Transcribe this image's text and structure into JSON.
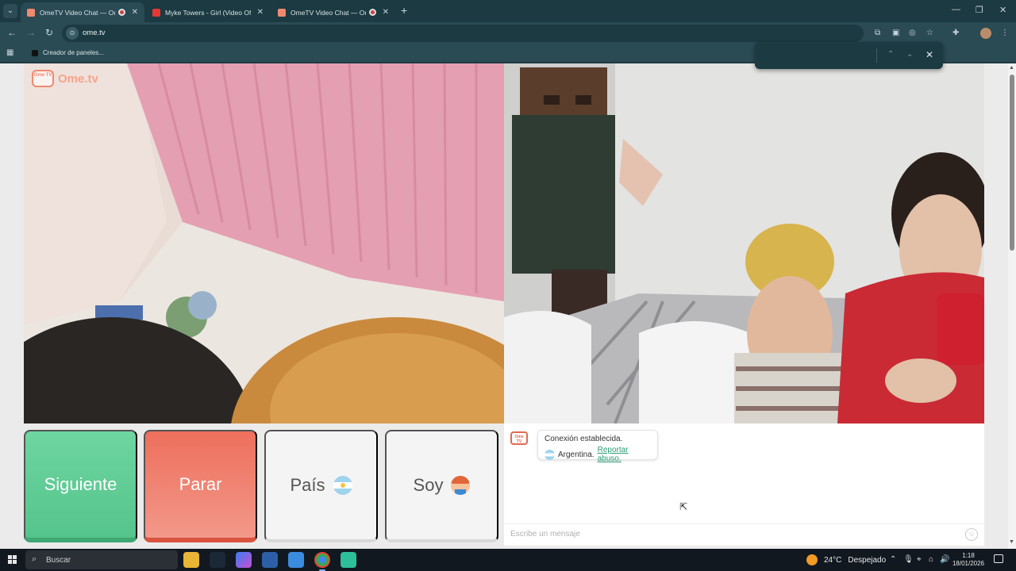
{
  "browser": {
    "tabs": [
      {
        "title": "OmeTV Video Chat — Omegle",
        "active": true,
        "recording": true
      },
      {
        "title": "Myke Towers - Girl (Video Oficial)",
        "active": false,
        "recording": false
      },
      {
        "title": "OmeTV Video Chat — Omegle",
        "active": false,
        "recording": true
      }
    ],
    "url": "ome.tv",
    "bookmarks": [
      {
        "label": "Creador de paneles..."
      }
    ]
  },
  "page": {
    "logo_text": "Ome.tv",
    "logo_badge": "Ome TV",
    "buttons": {
      "next": "Siguiente",
      "stop": "Parar",
      "country": "País",
      "gender": "Soy"
    },
    "chat": {
      "system_message_line1": "Conexión establecida.",
      "country": "Argentina.",
      "report_link": "Reportar abuso.",
      "input_placeholder": "Escribe un mensaje"
    }
  },
  "taskbar": {
    "search_placeholder": "Buscar",
    "weather_temp": "24°C",
    "weather_desc": "Despejado",
    "time": "1:18",
    "date": "18/01/2026"
  },
  "colors": {
    "next_button": "#5fcd95",
    "stop_button": "#ef7a67",
    "link": "#2a9d76"
  }
}
